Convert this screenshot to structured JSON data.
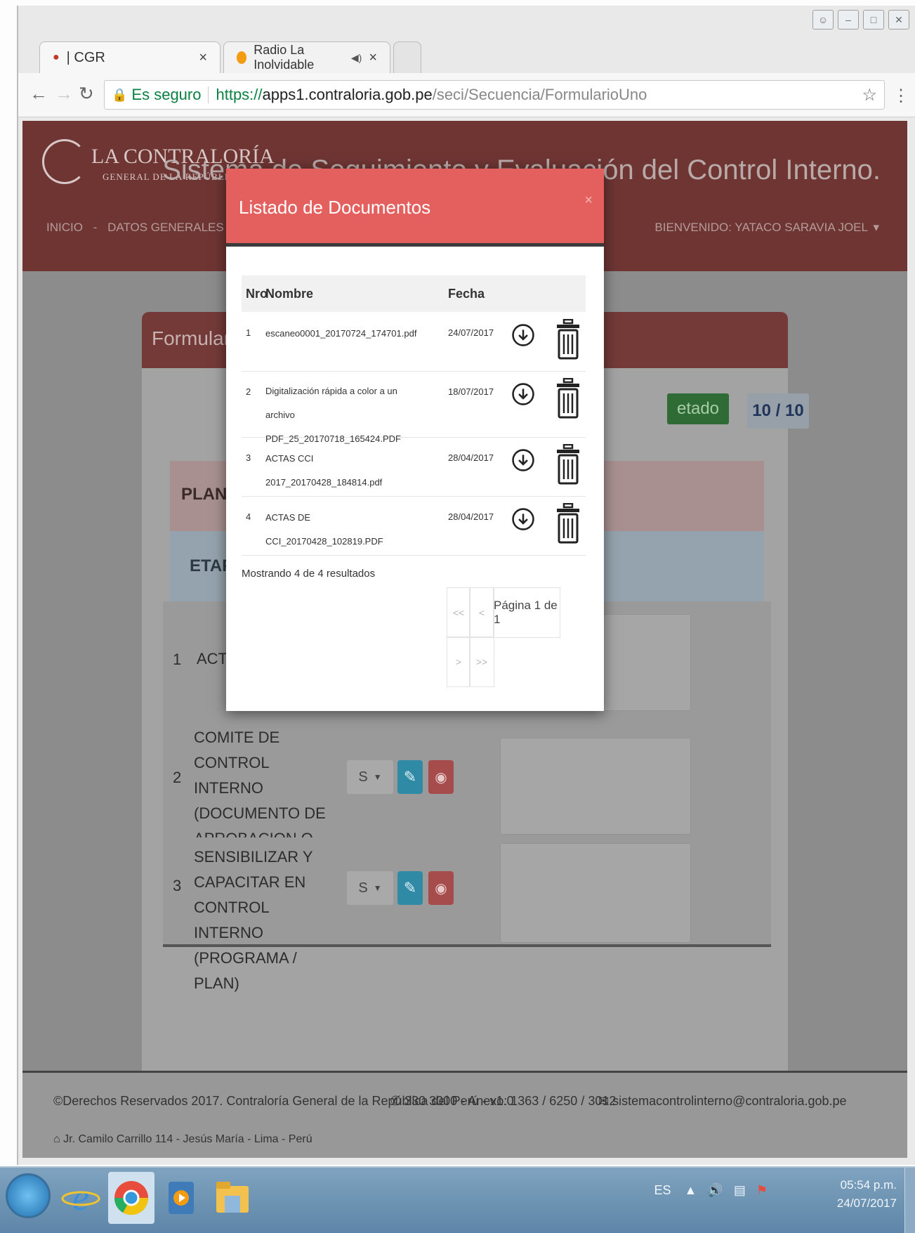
{
  "browser": {
    "tabs": [
      {
        "label": "| CGR",
        "close": "×"
      },
      {
        "label": "Radio La Inolvidable",
        "audio": "◀)",
        "close": "×"
      }
    ],
    "security_label": "Es seguro",
    "url_scheme": "https://",
    "url_host": "apps1.contraloria.gob.pe",
    "url_path": "/seci/Secuencia/FormularioUno"
  },
  "header": {
    "logo_main": "LA CONTRALORÍA",
    "logo_sub": "GENERAL DE LA REPÚBLICA",
    "system_title": "Sistema de Seguimiento y Evaluación del Control Interno.",
    "nav_inicio": "INICIO",
    "nav_datos": "DATOS GENERALES DE LA ENTIDAD",
    "welcome": "BIENVENIDO: YATACO SARAVIA JOEL"
  },
  "form": {
    "title": "Formulario Secu",
    "status_badge": "etado",
    "counter": "10 / 10",
    "plan_label": "PLANIFICA",
    "etapa_label": "ETAPA I -",
    "items": [
      {
        "num": "1",
        "label": "ACTA DE"
      },
      {
        "num": "2",
        "label": "COMITE DE CONTROL INTERNO (DOCUMENTO DE APROBACION O MODIFICACION)",
        "select": "S"
      },
      {
        "num": "3",
        "label": "SENSIBILIZAR Y CAPACITAR EN CONTROL INTERNO (PROGRAMA / PLAN)",
        "select": "S"
      }
    ]
  },
  "modal": {
    "title": "Listado de Documentos",
    "close": "×",
    "columns": {
      "nro": "Nro",
      "nombre": "Nombre",
      "fecha": "Fecha"
    },
    "rows": [
      {
        "nro": "1",
        "nombre": "escaneo0001_20170724_174701.pdf",
        "fecha": "24/07/2017"
      },
      {
        "nro": "2",
        "nombre": "Digitalización rápida a color a un archivo PDF_25_20170718_165424.PDF",
        "fecha": "18/07/2017"
      },
      {
        "nro": "3",
        "nombre": "ACTAS CCI 2017_20170428_184814.pdf",
        "fecha": "28/04/2017"
      },
      {
        "nro": "4",
        "nombre": "ACTAS DE CCI_20170428_102819.PDF",
        "fecha": "28/04/2017"
      }
    ],
    "showing": "Mostrando 4 de 4 resultados",
    "pager": {
      "first": "<<",
      "prev": "<",
      "label": "Página 1 de 1",
      "next": ">",
      "last": ">>"
    }
  },
  "footer": {
    "rights": "©Derechos Reservados 2017. Contraloría General de la República del Perú - v1.0",
    "phone": "330 3000 - Anexo: 1363 / 6250 / 3012",
    "email": "sistemacontrolinterno@contraloria.gob.pe",
    "address": "Jr. Camilo Carrillo 114 - Jesús María - Lima - Perú"
  },
  "taskbar": {
    "lang": "ES",
    "time": "05:54 p.m.",
    "date": "24/07/2017"
  }
}
